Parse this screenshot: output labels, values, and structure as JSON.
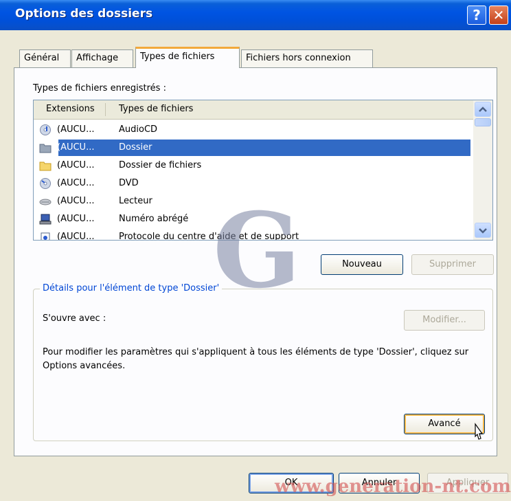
{
  "window": {
    "title": "Options des dossiers",
    "help_glyph": "?",
    "close_glyph": "✕"
  },
  "tabs": [
    {
      "label": "Général"
    },
    {
      "label": "Affichage"
    },
    {
      "label": "Types de fichiers",
      "active": true
    },
    {
      "label": "Fichiers hors connexion"
    }
  ],
  "registered_label": "Types de fichiers enregistrés :",
  "list": {
    "col_extensions": "Extensions",
    "col_types": "Types de fichiers",
    "rows": [
      {
        "ext": "(AUCU...",
        "type": "AudioCD",
        "icon": "audio-cd-icon"
      },
      {
        "ext": "(AUCU...",
        "type": "Dossier",
        "icon": "folder-icon",
        "selected": true
      },
      {
        "ext": "(AUCU...",
        "type": "Dossier de fichiers",
        "icon": "folder-open-icon"
      },
      {
        "ext": "(AUCU...",
        "type": "DVD",
        "icon": "dvd-icon"
      },
      {
        "ext": "(AUCU...",
        "type": "Lecteur",
        "icon": "drive-icon"
      },
      {
        "ext": "(AUCU...",
        "type": "Numéro abrégé",
        "icon": "computer-icon"
      },
      {
        "ext": "(AUCU...",
        "type": "Protocole du centre d'aide et de support",
        "icon": "help-doc-icon"
      }
    ]
  },
  "buttons": {
    "new": "Nouveau",
    "delete": "Supprimer",
    "modify": "Modifier...",
    "advanced": "Avancé",
    "ok": "OK",
    "cancel": "Annuler",
    "apply": "Appliquer"
  },
  "details": {
    "title": "Détails pour l'élément de type 'Dossier'",
    "opens_with": "S'ouvre avec :",
    "description": "Pour modifier les paramètres qui s'appliquent à tous les éléments de type 'Dossier', cliquez sur Options avancées."
  },
  "watermark": {
    "logo_letter": "G",
    "url": "www.generation-nt.com"
  }
}
